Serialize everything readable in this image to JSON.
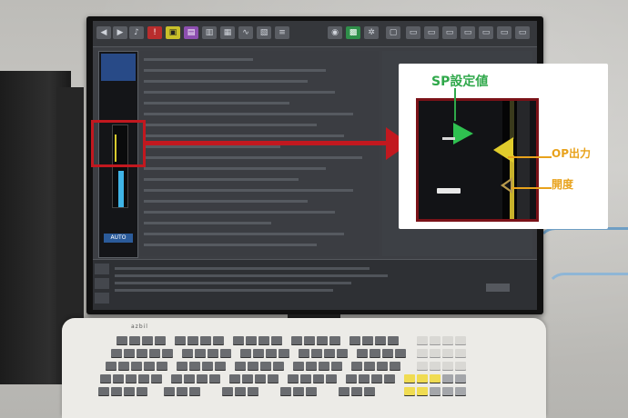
{
  "annotations": {
    "sp_label": "SP設定値",
    "op_label": "OP出力",
    "opening_label": "開度"
  },
  "left_panel": {
    "mode_label": "AUTO"
  },
  "keyboard": {
    "brand": "azbil"
  },
  "colors": {
    "highlight_red": "#c2181f",
    "sp_green": "#2fa84a",
    "op_orange": "#e8a21c",
    "op_yellow": "#e0cc2c",
    "bar_blue": "#3fb4e6",
    "screen_bg": "#3c3e43"
  },
  "icons": [
    "back-icon",
    "forward-icon",
    "speaker-icon",
    "alarm-icon",
    "camera-icon",
    "gear-icon",
    "monitor-icon"
  ]
}
